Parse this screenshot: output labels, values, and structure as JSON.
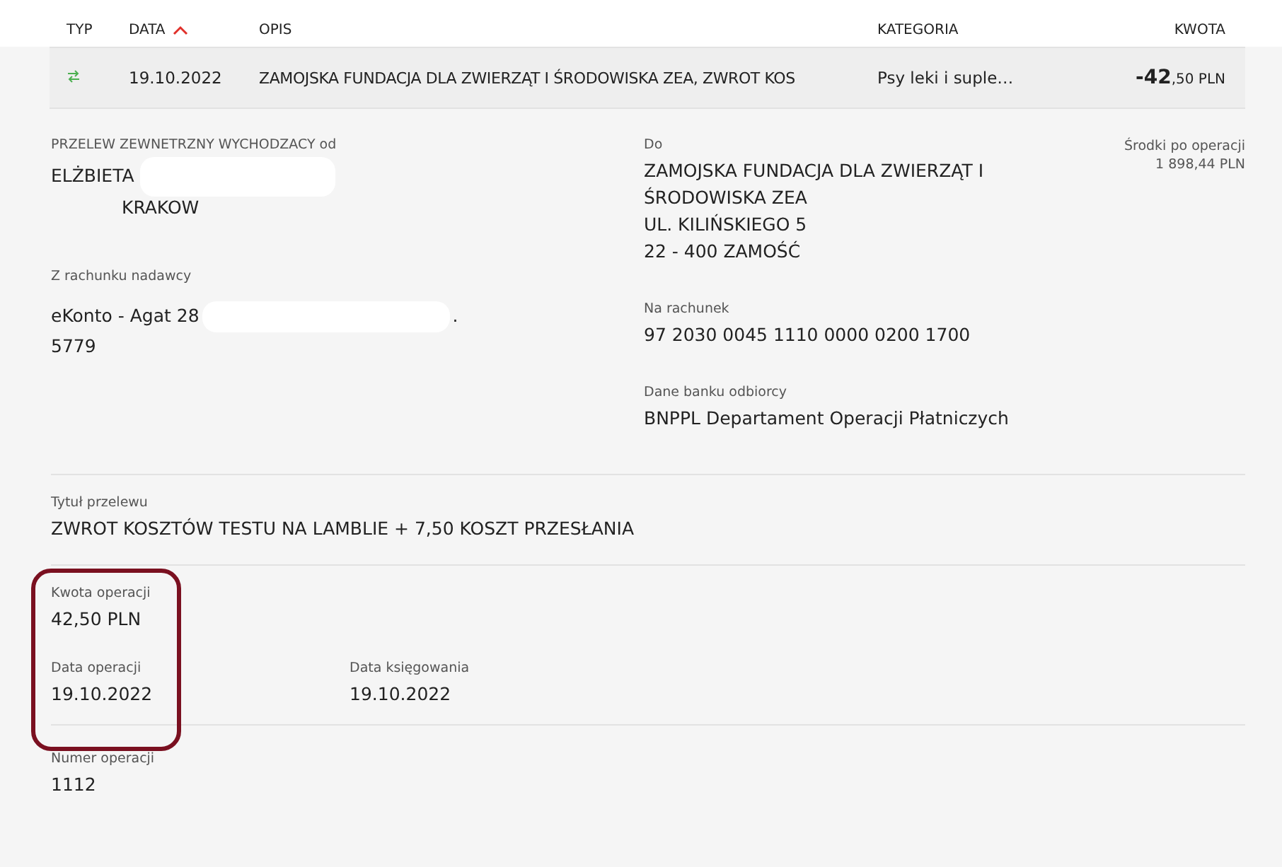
{
  "table": {
    "columns": [
      {
        "label": "TYP",
        "sorted": false
      },
      {
        "label": "DATA",
        "sorted": true
      },
      {
        "label": "OPIS",
        "sorted": false
      },
      {
        "label": "KATEGORIA",
        "sorted": false
      },
      {
        "label": "KWOTA",
        "sorted": false
      }
    ],
    "rows": [
      {
        "kind": "transfer",
        "date": "19.10.2022",
        "description": "ZAMOJSKA FUNDACJA DLA ZWIERZĄT I ŚRODOWISKA ZEA, ZWROT KOS",
        "category": "Psy leki i suple…",
        "amount_whole": "-42",
        "amount_rest": ",50 PLN",
        "expanded": true
      }
    ]
  },
  "details": {
    "sender": {
      "label": "PRZELEW ZEWNETRZNY WYCHODZACY od",
      "name": "ELŻBIETA",
      "city": "KRAKOW"
    },
    "recipient": {
      "label": "Do",
      "lines": [
        "ZAMOJSKA FUNDACJA DLA ZWIERZĄT I",
        "ŚRODOWISKA ZEA",
        "UL. KILIŃSKIEGO 5",
        "22 - 400 ZAMOŚĆ"
      ]
    },
    "balance": {
      "label": "Środki po operacji",
      "value": "1 898,44 PLN"
    },
    "from_account": {
      "label": "Z rachunku nadawcy",
      "prefix": "eKonto - Agat 28",
      "suffix": ".",
      "last_line": "5779"
    },
    "to_account": {
      "label": "Na rachunek",
      "value": "97 2030 0045 1110 0000 0200 1700"
    },
    "bank": {
      "label": "Dane banku odbiorcy",
      "value": "BNPPL Departament Operacji Płatniczych"
    },
    "title": {
      "label": "Tytuł przelewu",
      "value": "ZWROT KOSZTÓW TESTU NA LAMBLIE + 7,50 KOSZT PRZESŁANIA"
    },
    "amount": {
      "label": "Kwota operacji",
      "value": "42,50 PLN",
      "highlighted": true
    },
    "operation_date": {
      "label": "Data operacji",
      "value": "19.10.2022"
    },
    "booking_date": {
      "label": "Data księgowania",
      "value": "19.10.2022"
    },
    "operation_number": {
      "label": "Numer operacji",
      "value": "1112"
    }
  }
}
